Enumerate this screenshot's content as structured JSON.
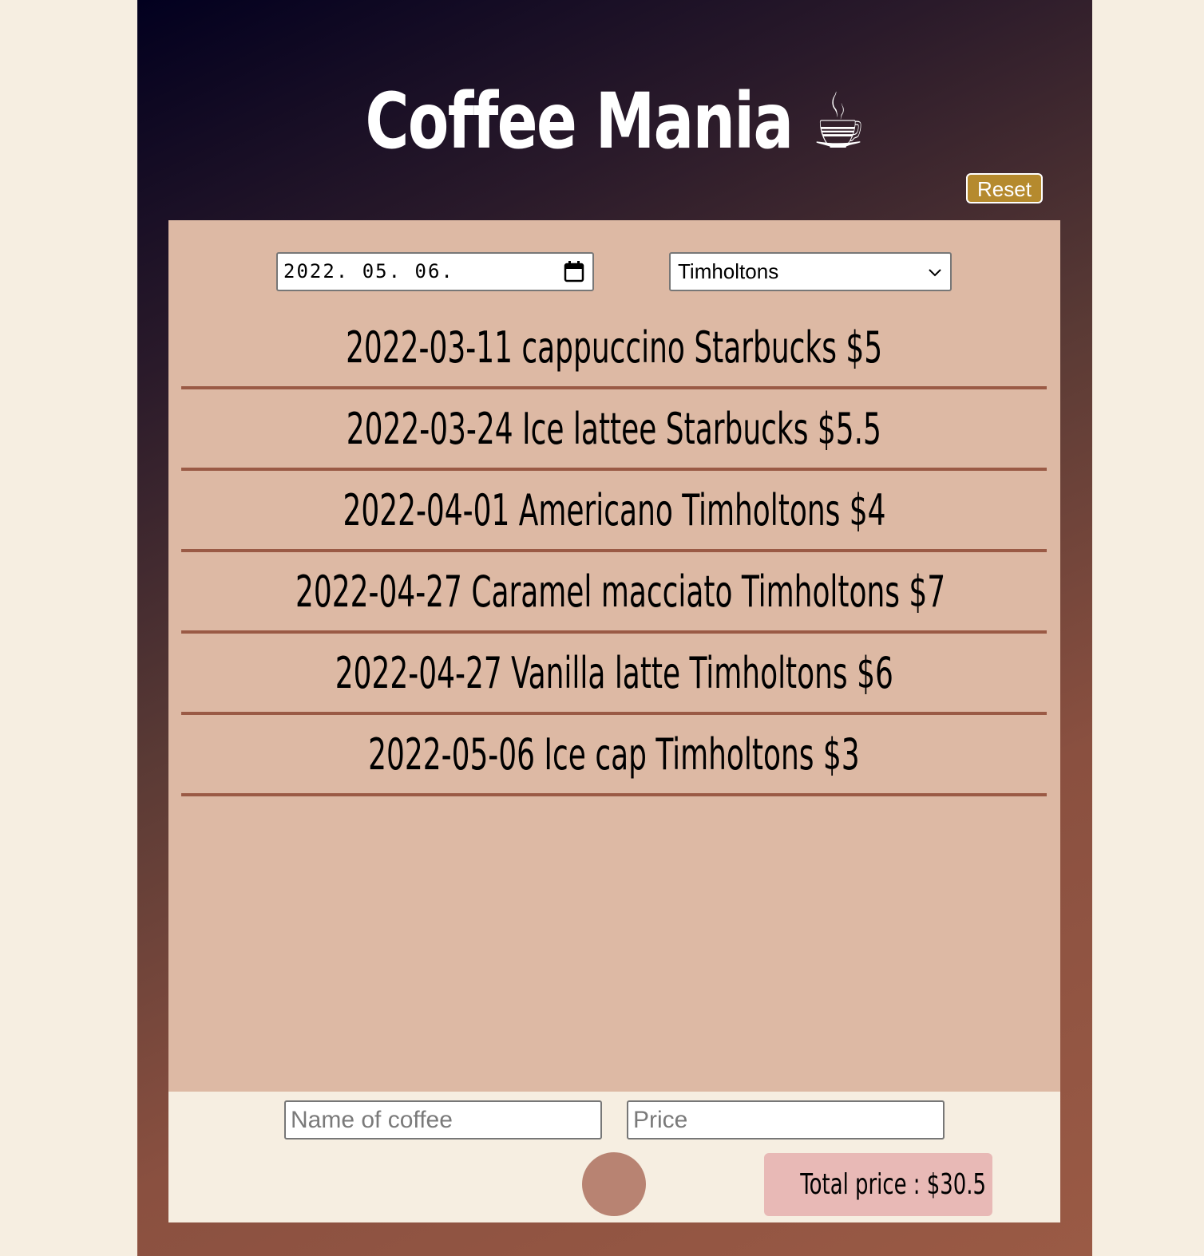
{
  "header": {
    "title": "Coffee Mania ☕",
    "reset_label": "Reset"
  },
  "filters": {
    "date_value": "2022. 05. 06.",
    "store_selected": "Timholtons"
  },
  "entries": [
    "2022-03-11 cappuccino Starbucks $5",
    "2022-03-24 Ice lattee Starbucks $5.5",
    "2022-04-01 Americano Timholtons $4",
    "2022-04-27 Caramel macciato Timholtons $7",
    "2022-04-27 Vanilla latte Timholtons $6",
    "2022-05-06 Ice cap Timholtons $3"
  ],
  "form": {
    "name_placeholder": "Name of coffee",
    "name_value": "",
    "price_placeholder": "Price",
    "price_value": ""
  },
  "total": {
    "label": "Total price : $30.5"
  },
  "colors": {
    "accent_reset": "#b58a2e",
    "panel": "#ddb9a4",
    "row_divider": "#9a5a45",
    "add_button": "#b88372",
    "total_badge": "#e8b9b6"
  }
}
